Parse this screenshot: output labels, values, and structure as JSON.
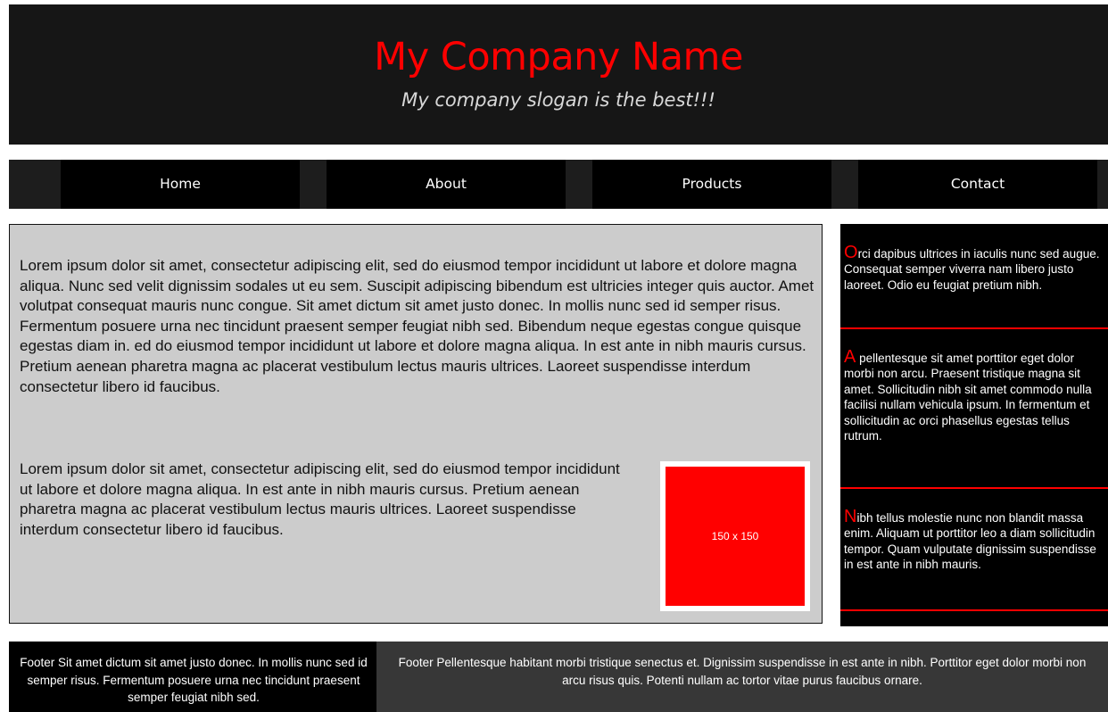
{
  "header": {
    "company_name": "My Company Name",
    "slogan": "My company slogan is the best!!!"
  },
  "nav": {
    "items": [
      {
        "label": "Home"
      },
      {
        "label": "About"
      },
      {
        "label": "Products"
      },
      {
        "label": "Contact"
      }
    ]
  },
  "main": {
    "paragraph_1": "Lorem ipsum dolor sit amet, consectetur adipiscing elit, sed do eiusmod tempor incididunt ut labore et dolore magna aliqua. Nunc sed velit dignissim sodales ut eu sem. Suscipit adipiscing bibendum est ultricies integer quis auctor. Amet volutpat consequat mauris nunc congue. Sit amet dictum sit amet justo donec. In mollis nunc sed id semper risus. Fermentum posuere urna nec tincidunt praesent semper feugiat nibh sed. Bibendum neque egestas congue quisque egestas diam in. ed do eiusmod tempor incididunt ut labore et dolore magna aliqua. In est ante in nibh mauris cursus. Pretium aenean pharetra magna ac placerat vestibulum lectus mauris ultrices. Laoreet suspendisse interdum consectetur libero id faucibus.",
    "paragraph_2": "Lorem ipsum dolor sit amet, consectetur adipiscing elit, sed do eiusmod tempor incididunt ut labore et dolore magna aliqua. In est ante in nibh mauris cursus. Pretium aenean pharetra magna ac placerat vestibulum lectus mauris ultrices. Laoreet suspendisse interdum consectetur libero id faucibus.",
    "image_placeholder_label": "150 x 150"
  },
  "sidebar": {
    "items": [
      {
        "dropcap": "O",
        "text": "rci dapibus ultrices in iaculis nunc sed augue. Consequat semper viverra nam libero justo laoreet. Odio eu feugiat pretium nibh."
      },
      {
        "dropcap": "A",
        "text": " pellentesque sit amet porttitor eget dolor morbi non arcu. Praesent tristique magna sit amet. Sollicitudin nibh sit amet commodo nulla facilisi nullam vehicula ipsum. In fermentum et sollicitudin ac orci phasellus egestas tellus rutrum."
      },
      {
        "dropcap": "N",
        "text": "ibh tellus molestie nunc non blandit massa enim. Aliquam ut porttitor leo a diam sollicitudin tempor. Quam vulputate dignissim suspendisse in est ante in nibh mauris."
      }
    ]
  },
  "footer": {
    "left_text": "Footer Sit amet dictum sit amet justo donec. In mollis nunc sed id semper risus. Fermentum posuere urna nec tincidunt praesent semper feugiat nibh sed.",
    "right_text": "Footer Pellentesque habitant morbi tristique senectus et. Dignissim suspendisse in est ante in nibh. Porttitor eget dolor morbi non arcu risus quis. Potenti nullam ac tortor vitae purus faucibus ornare."
  },
  "colors": {
    "accent": "#ff0000",
    "header_bg": "#161616",
    "nav_bg": "#000000",
    "main_bg": "#cccccc",
    "sidebar_bg": "#000000",
    "footer_left_bg": "#000000",
    "footer_right_bg": "#373737"
  }
}
